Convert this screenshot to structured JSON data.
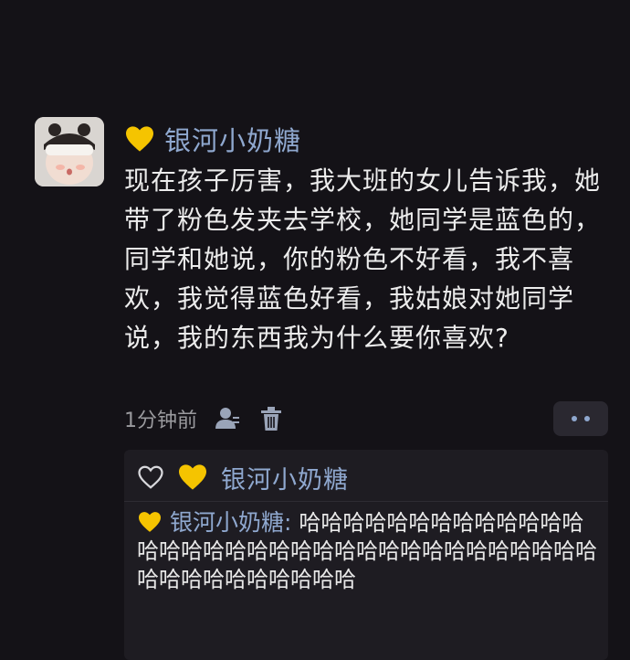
{
  "comment": {
    "username": "银河小奶糖",
    "text": "现在孩子厉害，我大班的女儿告诉我，她带了粉色发夹去学校，她同学是蓝色的，同学和她说，你的粉色不好看，我不喜欢，我觉得蓝色好看，我姑娘对她同学说，我的东西我为什么要你喜欢?",
    "time": "1分钟前"
  },
  "reply_box": {
    "username": "银河小奶糖",
    "reply": {
      "username": "银河小奶糖",
      "separator": ": ",
      "text": "哈哈哈哈哈哈哈哈哈哈哈哈哈哈哈哈哈哈哈哈哈哈哈哈哈哈哈哈哈哈哈哈哈哈哈哈哈哈哈哈哈哈哈哈"
    }
  },
  "colors": {
    "background": "#141217",
    "username": "#8fa8cf",
    "heart": "#f5c400"
  },
  "icons": {
    "avatar": "avatar",
    "badge": "yellow-heart-icon",
    "like": "heart-outline-icon",
    "user": "person-icon",
    "delete": "trash-icon",
    "more": "more-dots-icon"
  }
}
